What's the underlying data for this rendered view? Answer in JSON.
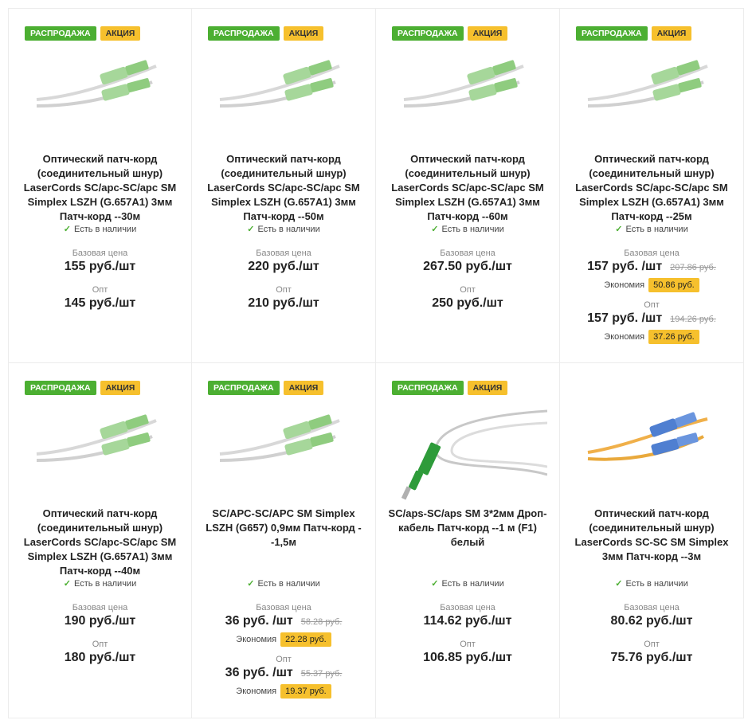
{
  "badges": {
    "sale": "РАСПРОДАЖА",
    "promo": "АКЦИЯ"
  },
  "labels": {
    "in_stock": "Есть в наличии",
    "base_price": "Базовая цена",
    "wholesale": "Опт",
    "savings": "Экономия"
  },
  "products": [
    {
      "title": "Оптический патч-корд (соединительный шнур) LaserCords SC/apc-SC/apc SM Simplex LSZH (G.657A1) 3мм Патч-корд --30м",
      "base_price": "155 руб./шт",
      "wholesale_price": "145 руб./шт"
    },
    {
      "title": "Оптический патч-корд (соединительный шнур) LaserCords SC/apc-SC/apc SM Simplex LSZH (G.657A1) 3мм Патч-корд --50м",
      "base_price": "220 руб./шт",
      "wholesale_price": "210 руб./шт"
    },
    {
      "title": "Оптический патч-корд (соединительный шнур) LaserCords SC/apc-SC/apc SM Simplex LSZH (G.657A1) 3мм Патч-корд --60м",
      "base_price": "267.50 руб./шт",
      "wholesale_price": "250 руб./шт"
    },
    {
      "title": "Оптический патч-корд (соединительный шнур) LaserCords SC/apc-SC/apc SM Simplex LSZH (G.657A1) 3мм Патч-корд --25м",
      "base_price": "157 руб. /шт",
      "base_old": "207.86 руб.",
      "base_save": "50.86 руб.",
      "wholesale_price": "157 руб. /шт",
      "wholesale_old": "194.26 руб.",
      "wholesale_save": "37.26 руб."
    },
    {
      "title": "Оптический патч-корд (соединительный шнур) LaserCords SC/apc-SC/apc SM Simplex LSZH (G.657A1) 3мм Патч-корд --40м",
      "base_price": "190 руб./шт",
      "wholesale_price": "180 руб./шт"
    },
    {
      "title": "SC/APC-SC/APC SM Simplex LSZH (G657) 0,9мм Патч-корд --1,5м",
      "base_price": "36 руб. /шт",
      "base_old": "58.28 руб.",
      "base_save": "22.28 руб.",
      "wholesale_price": "36 руб. /шт",
      "wholesale_old": "55.37 руб.",
      "wholesale_save": "19.37 руб."
    },
    {
      "title": "SC/aps-SC/aps SM 3*2мм Дроп-кабель Патч-корд --1 м (F1) белый",
      "base_price": "114.62 руб./шт",
      "wholesale_price": "106.85 руб./шт"
    },
    {
      "title": "Оптический патч-корд (соединительный шнур) LaserCords SC-SC SM Simplex 3мм Патч-корд --3м",
      "base_price": "80.62 руб./шт",
      "wholesale_price": "75.76 руб./шт"
    }
  ]
}
